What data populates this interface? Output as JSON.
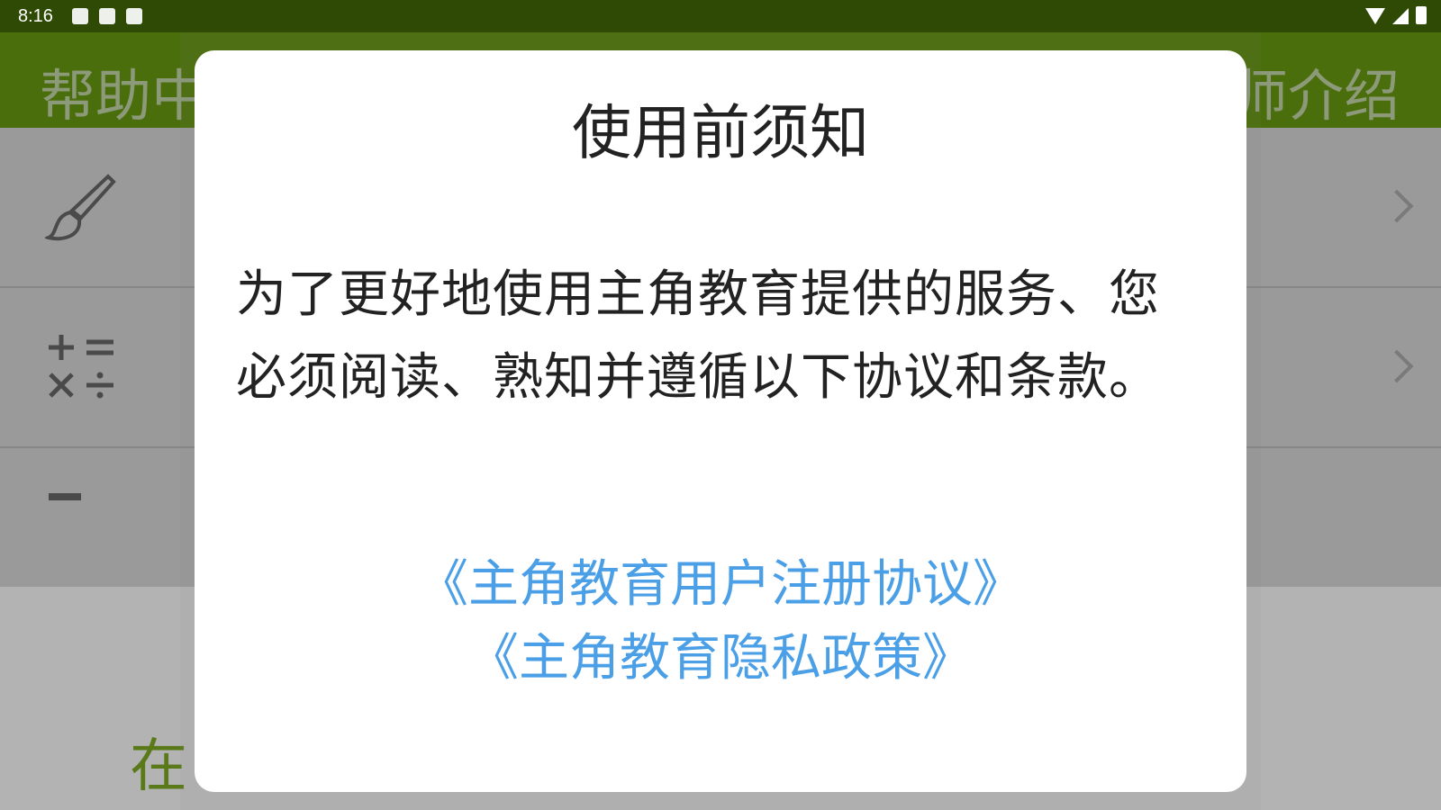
{
  "status_bar": {
    "time": "8:16",
    "left_icons": [
      "image-icon",
      "android-icon",
      "a-icon"
    ],
    "right_icons": [
      "wifi-icon",
      "signal-icon",
      "battery-icon"
    ]
  },
  "app_bar": {
    "title_left_visible": "帮助中",
    "title_right_visible": "师介绍",
    "color": "#4b6e0d"
  },
  "list": {
    "rows": [
      {
        "icon": "paintbrush-icon",
        "label_visible": ""
      },
      {
        "icon": "calculator-symbols-icon",
        "label_visible": ""
      },
      {
        "icon": "partial-icon",
        "label_visible": ""
      }
    ]
  },
  "bottom": {
    "text_visible": "在"
  },
  "dialog": {
    "title": "使用前须知",
    "body": "为了更好地使用主角教育提供的服务、您必须阅读、熟知并遵循以下协议和条款。",
    "links": [
      "《主角教育用户注册协议》",
      "《主角教育隐私政策》"
    ],
    "link_color": "#4a9fe6"
  }
}
